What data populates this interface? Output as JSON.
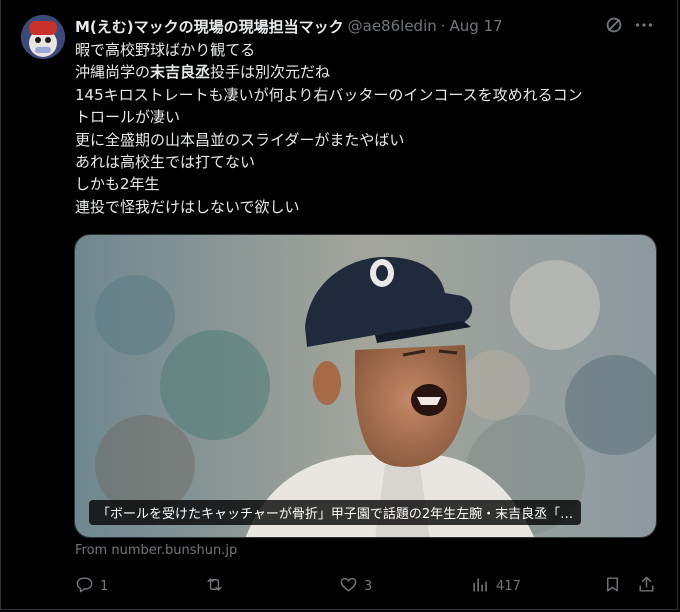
{
  "colors": {
    "background": "#000000",
    "text_primary": "#e7e9ea",
    "text_secondary": "#71767b",
    "border": "#2f3336"
  },
  "tweet": {
    "display_name": "M(えむ)マックの現場の現場担当マック",
    "handle": "@ae86ledin",
    "separator": "·",
    "date": "Aug 17",
    "body_lines": [
      "暇で高校野球ばかり観てる",
      "沖縄尚学の",
      "末吉良丞",
      "投手は別次元だね",
      "145キロストレートも凄いが何より右バッターのインコースを攻めれるコン",
      "トロールが凄い",
      "更に全盛期の山本昌並のスライダーがまたやばい",
      "あれは高校生では打てない",
      "しかも2年生",
      "連投で怪我だけはしないで欲しい"
    ],
    "card": {
      "title": "「ボールを受けたキャッチャーが骨折」甲子園で話題の2年生左腕・末吉良丞「…",
      "source": "From number.bunshun.jp"
    },
    "actions": {
      "reply_count": "1",
      "retweet_count": "",
      "like_count": "3",
      "view_count": "417"
    },
    "icons": [
      "grok-icon",
      "more-icon",
      "reply-icon",
      "retweet-icon",
      "like-icon",
      "views-icon",
      "bookmark-icon",
      "share-icon"
    ]
  }
}
